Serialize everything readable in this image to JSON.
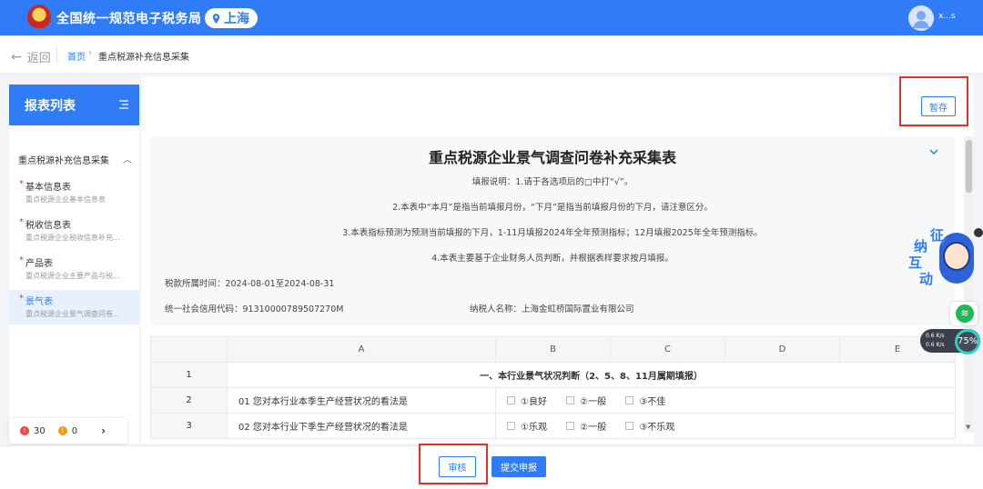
{
  "header": {
    "site_title": "全国统一规范电子税务局",
    "region": "上海",
    "user_name": "x...s"
  },
  "breadcrumb": {
    "back_label": "返回",
    "home": "首页",
    "separator": "›",
    "current": "重点税源补充信息采集"
  },
  "sidebar": {
    "title": "报表列表",
    "group_label": "重点税源补充信息采集",
    "items": [
      {
        "title": "基本信息表",
        "subtitle": "重点税源企业基本信息表"
      },
      {
        "title": "税收信息表",
        "subtitle": "重点税源企业税收信息补充..."
      },
      {
        "title": "产品表",
        "subtitle": "重点税源企业主要产品与税..."
      },
      {
        "title": "景气表",
        "subtitle": "重点税源企业景气调查问卷..."
      }
    ],
    "active_index": 3,
    "error_count": "30",
    "warning_count": "0"
  },
  "toolbar": {
    "save_label": "暂存"
  },
  "form": {
    "title": "重点税源企业景气调查问卷补充采集表",
    "notes": [
      "填报说明：1.请于各选项后的□中打“√”。",
      "2.本表中“本月”是指当前填报月份，“下月”是指当前填报月份的下月，请注意区分。",
      "3.本表指标预测为预测当前填报的下月，1-11月填报2024年全年预测指标；12月填报2025年全年预测指标。",
      "4.本表主要基于企业财务人员判断，并根据表样要求按月填报。"
    ],
    "period_label": "税款所属时间：2024-08-01至2024-08-31",
    "credit_code_label": "统一社会信用代码：91310000789507270M",
    "taxpayer_label": "纳税人名称：上海金虹桥国际置业有限公司"
  },
  "table": {
    "columns": [
      "",
      "A",
      "B",
      "C",
      "D",
      "E"
    ],
    "rows": [
      {
        "index": "1",
        "section": "一、本行业景气状况判断（2、5、8、11月属期填报）"
      },
      {
        "index": "2",
        "question": "01 您对本行业本季生产经营状况的看法是",
        "options": [
          "①良好",
          "②一般",
          "③不佳"
        ]
      },
      {
        "index": "3",
        "question": "02 您对本行业下季生产经营状况的看法是",
        "options": [
          "①乐观",
          "②一般",
          "③不乐观"
        ]
      }
    ]
  },
  "footer": {
    "audit_label": "审核",
    "submit_label": "提交申报"
  },
  "widgets": {
    "assistant_chars": [
      "征",
      "纳",
      "互",
      "动"
    ],
    "speed_up": "0.6 K/s",
    "speed_down": "0.6 K/s",
    "speed_percent": "75%"
  },
  "colors": {
    "primary": "#2f7cf6",
    "highlight_box": "#e0312b"
  }
}
